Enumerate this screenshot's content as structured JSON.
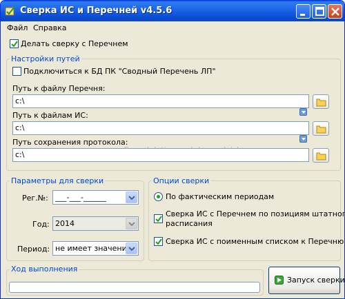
{
  "window": {
    "title": "Сверка ИС и Перечней v4.5.6"
  },
  "menu": {
    "items": [
      "Файл",
      "Справка"
    ]
  },
  "main": {
    "do_check_label": "Делать сверку с Перечнем",
    "do_check_checked": true
  },
  "paths": {
    "group_title": "Настройки путей",
    "connect_db_label": "Подключиться к БД ПК \"Сводный Перечень ЛП\"",
    "connect_db_checked": false,
    "list_file_label": "Путь к файлу Перечня:",
    "list_file_value": "c:\\",
    "is_files_label": "Путь к файлам ИС:",
    "is_files_value": "c:\\",
    "protocol_label": "Путь сохранения протокола:",
    "protocol_value": "c:\\"
  },
  "watermark": "Casual dating portals vergleich",
  "params": {
    "group_title": "Параметры для сверки",
    "reg_label": "Рег.№:",
    "reg_value": "___-___-______",
    "year_label": "Год:",
    "year_value": "2014",
    "period_label": "Период:",
    "period_value": "не имеет значения"
  },
  "options": {
    "group_title": "Опции сверки",
    "actual_periods_label": "По фактическим периодам",
    "actual_periods_selected": true,
    "staff_check_label_line1": "Сверка ИС с Перечнем по позициям штатного",
    "staff_check_label_line2": "расписания",
    "staff_check_checked": true,
    "named_list_label": "Сверка ИС с поименным списком к Перечню",
    "named_list_checked": true
  },
  "progress": {
    "group_title": "Ход выполнения",
    "value": 0
  },
  "actions": {
    "start_label": "Запуск сверки"
  },
  "colors": {
    "title_bar": "#0a4fd6",
    "group_title": "#0046d5",
    "window_bg": "#ece9d8",
    "check_mark": "#21a121"
  }
}
